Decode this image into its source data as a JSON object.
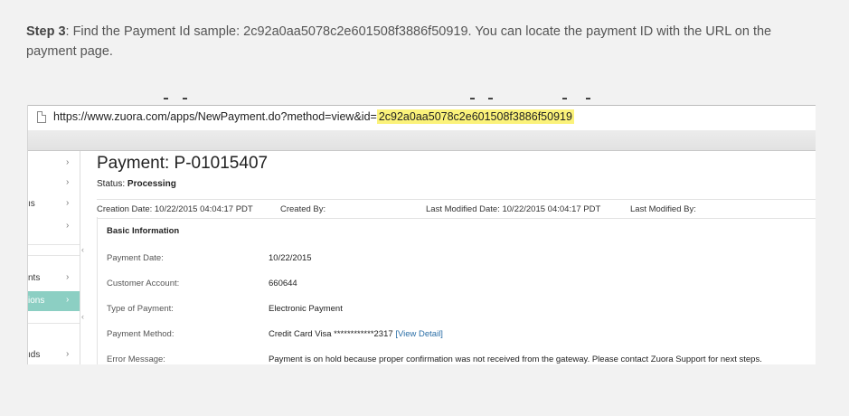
{
  "step": {
    "label": "Step 3",
    "text": ": Find the Payment Id sample: 2c92a0aa5078c2e601508f3886f50919. You can locate the payment ID with the URL on the payment page."
  },
  "browser": {
    "url_prefix": "https://www.zuora.com/apps/NewPayment.do?method=view&id=",
    "url_highlight": "2c92a0aa5078c2e601508f3886f50919",
    "highlight_color": "#fbf27a"
  },
  "sidebar": {
    "items": [
      {
        "label": "",
        "chevron": "›"
      },
      {
        "label": "",
        "chevron": "›"
      },
      {
        "label": "ıs",
        "chevron": "›"
      },
      {
        "label": "",
        "chevron": "›"
      },
      {
        "label": "nts",
        "chevron": "›"
      },
      {
        "label": "ions",
        "chevron": "›",
        "active": true
      },
      {
        "label": "ıds",
        "chevron": "›"
      }
    ],
    "active_color": "#8ccfc3"
  },
  "collapse_glyph": "‹",
  "payment": {
    "title": "Payment: P-01015407",
    "status_label": "Status: ",
    "status_value": "Processing",
    "creation_date": "Creation Date: 10/22/2015 04:04:17 PDT",
    "created_by": "Created By:",
    "last_modified_date": "Last Modified Date: 10/22/2015 04:04:17 PDT",
    "last_modified_by": "Last Modified By:"
  },
  "basic_info": {
    "heading": "Basic Information",
    "rows": [
      {
        "key": "Payment Date:",
        "value": "10/22/2015"
      },
      {
        "key": "Customer Account:",
        "value": "660644"
      },
      {
        "key": "Type of Payment:",
        "value": "Electronic Payment"
      },
      {
        "key": "Payment Method:",
        "value": "Credit Card Visa ************2317",
        "link": "[View Detail]"
      },
      {
        "key": "Error Message:",
        "value": "Payment is on hold because proper confirmation was not received from the gateway. Please contact Zuora Support for next steps."
      }
    ],
    "link_color": "#2a6ea6",
    "error_color": "#d23a2a"
  }
}
